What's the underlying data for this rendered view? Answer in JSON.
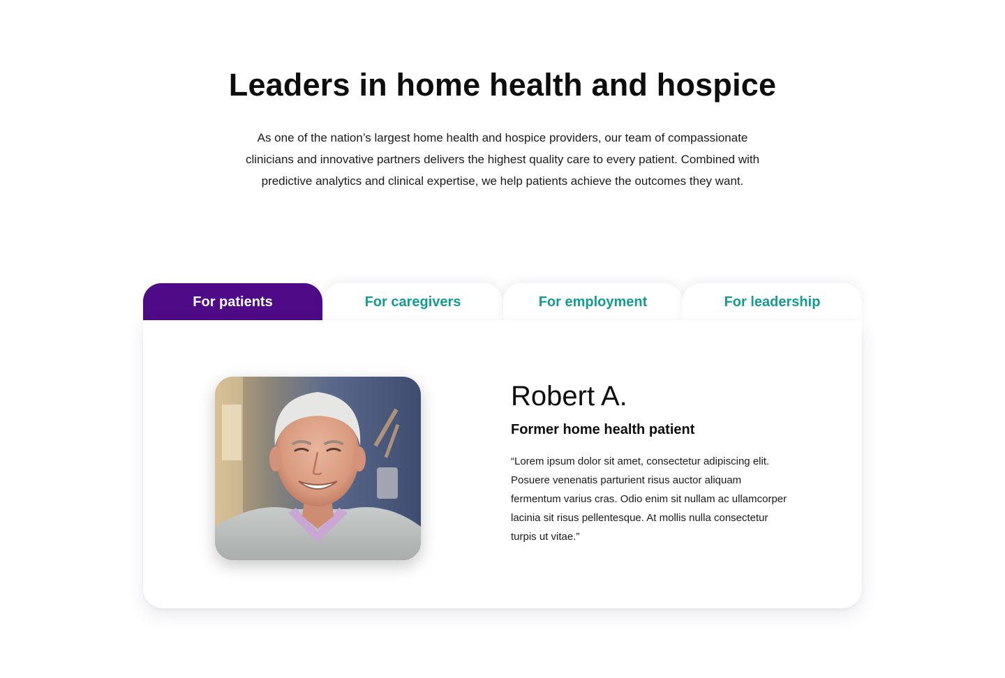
{
  "hero": {
    "title": "Leaders in home health and hospice",
    "description": "As one of the nation’s largest home health and hospice providers, our team of compassionate clinicians and innovative partners delivers the highest quality care to every patient. Combined with predictive analytics and clinical expertise, we help patients achieve the outcomes they want."
  },
  "tabs": [
    {
      "label": "For patients",
      "active": true
    },
    {
      "label": "For caregivers",
      "active": false
    },
    {
      "label": "For employment",
      "active": false
    },
    {
      "label": "For leadership",
      "active": false
    }
  ],
  "testimonial": {
    "name": "Robert A.",
    "role": "Former home health patient",
    "quote": "“Lorem ipsum dolor sit amet, consectetur adipiscing elit. Posuere venenatis parturient risus auctor aliquam fermentum varius cras. Odio enim sit nullam ac ullamcorper lacinia sit risus pellentesque. At mollis nulla consectetur turpis ut vitae.”",
    "photo": "portrait-of-smiling-older-man"
  },
  "colors": {
    "active_tab_bg": "#4e0a87",
    "tab_text": "#139c94",
    "active_tab_text": "#ffffff"
  }
}
